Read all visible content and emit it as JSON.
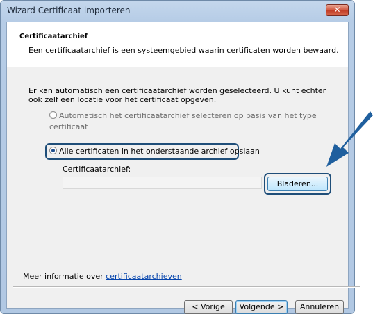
{
  "window": {
    "title": "Wizard Certificaat importeren",
    "close_glyph": "✕"
  },
  "header": {
    "title": "Certificaatarchief",
    "description": "Een certificaatarchief is een systeemgebied waarin certificaten worden bewaard."
  },
  "intro": "Er kan automatisch een certificaatarchief worden geselecteerd. U kunt echter ook zelf een locatie voor het certificaat opgeven.",
  "options": {
    "auto": {
      "label": "Automatisch het certificaatarchief selecteren op basis van het type certificaat",
      "selected": false
    },
    "manual": {
      "label": "Alle certificaten in het onderstaande archief opslaan",
      "selected": true
    }
  },
  "store": {
    "label": "Certificaatarchief:",
    "value": ""
  },
  "buttons": {
    "browse": "Bladeren...",
    "back": "< Vorige",
    "next": "Volgende >",
    "cancel": "Annuleren"
  },
  "more_info": {
    "prefix": "Meer informatie over ",
    "link": "certificaatarchieven"
  },
  "colors": {
    "highlight": "#1f4e79",
    "arrow": "#1f5f9e",
    "link": "#0645ad"
  },
  "icons": {
    "close": "close-icon",
    "annotation": "arrow-pointer-icon"
  }
}
